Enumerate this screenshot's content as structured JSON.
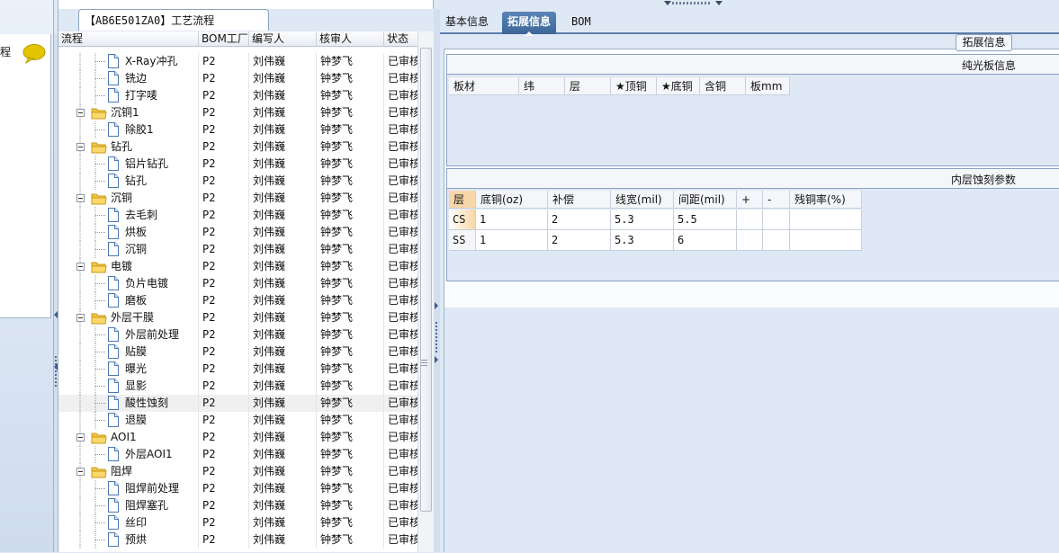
{
  "left_panel": {
    "label": "程",
    "icon": "speech-bubble-icon",
    "icon_color": "#e4c300"
  },
  "process_panel": {
    "title": "【AB6E501ZA0】工艺流程",
    "columns": [
      "流程",
      "BOM工厂",
      "编写人",
      "核审人",
      "状态"
    ],
    "rows": [
      {
        "level": 2,
        "type": "step",
        "name": "X-Ray冲孔",
        "bom": "P2",
        "writer": "刘伟巍",
        "checker": "钟梦飞",
        "status": "已审核"
      },
      {
        "level": 2,
        "type": "step",
        "name": "铣边",
        "bom": "P2",
        "writer": "刘伟巍",
        "checker": "钟梦飞",
        "status": "已审核"
      },
      {
        "level": 2,
        "type": "step",
        "name": "打字唛",
        "bom": "P2",
        "writer": "刘伟巍",
        "checker": "钟梦飞",
        "status": "已审核"
      },
      {
        "level": 1,
        "type": "folder",
        "name": "沉铜1",
        "bom": "P2",
        "writer": "刘伟巍",
        "checker": "钟梦飞",
        "status": "已审核"
      },
      {
        "level": 2,
        "type": "step",
        "name": "除胶1",
        "bom": "P2",
        "writer": "刘伟巍",
        "checker": "钟梦飞",
        "status": "已审核"
      },
      {
        "level": 1,
        "type": "folder",
        "name": "钻孔",
        "bom": "P2",
        "writer": "刘伟巍",
        "checker": "钟梦飞",
        "status": "已审核"
      },
      {
        "level": 2,
        "type": "step",
        "name": "铝片钻孔",
        "bom": "P2",
        "writer": "刘伟巍",
        "checker": "钟梦飞",
        "status": "已审核"
      },
      {
        "level": 2,
        "type": "step",
        "name": "钻孔",
        "bom": "P2",
        "writer": "刘伟巍",
        "checker": "钟梦飞",
        "status": "已审核"
      },
      {
        "level": 1,
        "type": "folder",
        "name": "沉铜",
        "bom": "P2",
        "writer": "刘伟巍",
        "checker": "钟梦飞",
        "status": "已审核"
      },
      {
        "level": 2,
        "type": "step",
        "name": "去毛刺",
        "bom": "P2",
        "writer": "刘伟巍",
        "checker": "钟梦飞",
        "status": "已审核"
      },
      {
        "level": 2,
        "type": "step",
        "name": "烘板",
        "bom": "P2",
        "writer": "刘伟巍",
        "checker": "钟梦飞",
        "status": "已审核"
      },
      {
        "level": 2,
        "type": "step",
        "name": "沉铜",
        "bom": "P2",
        "writer": "刘伟巍",
        "checker": "钟梦飞",
        "status": "已审核"
      },
      {
        "level": 1,
        "type": "folder",
        "name": "电镀",
        "bom": "P2",
        "writer": "刘伟巍",
        "checker": "钟梦飞",
        "status": "已审核"
      },
      {
        "level": 2,
        "type": "step",
        "name": "负片电镀",
        "bom": "P2",
        "writer": "刘伟巍",
        "checker": "钟梦飞",
        "status": "已审核"
      },
      {
        "level": 2,
        "type": "step",
        "name": "磨板",
        "bom": "P2",
        "writer": "刘伟巍",
        "checker": "钟梦飞",
        "status": "已审核"
      },
      {
        "level": 1,
        "type": "folder",
        "name": "外层干膜",
        "bom": "P2",
        "writer": "刘伟巍",
        "checker": "钟梦飞",
        "status": "已审核"
      },
      {
        "level": 2,
        "type": "step",
        "name": "外层前处理",
        "bom": "P2",
        "writer": "刘伟巍",
        "checker": "钟梦飞",
        "status": "已审核"
      },
      {
        "level": 2,
        "type": "step",
        "name": "贴膜",
        "bom": "P2",
        "writer": "刘伟巍",
        "checker": "钟梦飞",
        "status": "已审核"
      },
      {
        "level": 2,
        "type": "step",
        "name": "曝光",
        "bom": "P2",
        "writer": "刘伟巍",
        "checker": "钟梦飞",
        "status": "已审核"
      },
      {
        "level": 2,
        "type": "step",
        "name": "显影",
        "bom": "P2",
        "writer": "刘伟巍",
        "checker": "钟梦飞",
        "status": "已审核"
      },
      {
        "level": 2,
        "type": "step",
        "name": "酸性蚀刻",
        "bom": "P2",
        "writer": "刘伟巍",
        "checker": "钟梦飞",
        "status": "已审核",
        "selected": true
      },
      {
        "level": 2,
        "type": "step",
        "name": "退膜",
        "bom": "P2",
        "writer": "刘伟巍",
        "checker": "钟梦飞",
        "status": "已审核"
      },
      {
        "level": 1,
        "type": "folder",
        "name": "AOI1",
        "bom": "P2",
        "writer": "刘伟巍",
        "checker": "钟梦飞",
        "status": "已审核"
      },
      {
        "level": 2,
        "type": "step",
        "name": "外层AOI1",
        "bom": "P2",
        "writer": "刘伟巍",
        "checker": "钟梦飞",
        "status": "已审核"
      },
      {
        "level": 1,
        "type": "folder",
        "name": "阻焊",
        "bom": "P2",
        "writer": "刘伟巍",
        "checker": "钟梦飞",
        "status": "已审核"
      },
      {
        "level": 2,
        "type": "step",
        "name": "阻焊前处理",
        "bom": "P2",
        "writer": "刘伟巍",
        "checker": "钟梦飞",
        "status": "已审核"
      },
      {
        "level": 2,
        "type": "step",
        "name": "阻焊塞孔",
        "bom": "P2",
        "writer": "刘伟巍",
        "checker": "钟梦飞",
        "status": "已审核"
      },
      {
        "level": 2,
        "type": "step",
        "name": "丝印",
        "bom": "P2",
        "writer": "刘伟巍",
        "checker": "钟梦飞",
        "status": "已审核"
      },
      {
        "level": 2,
        "type": "step",
        "name": "预烘",
        "bom": "P2",
        "writer": "刘伟巍",
        "checker": "钟梦飞",
        "status": "已审核"
      }
    ]
  },
  "tabs": [
    "基本信息",
    "拓展信息",
    "BOM"
  ],
  "active_tab": 1,
  "ext_info": {
    "group_title": "拓展信息",
    "board": {
      "title": "纯光板信息",
      "columns": [
        "板材",
        "纬",
        "层",
        "★顶铜",
        "★底铜",
        "含铜",
        "板mm"
      ]
    },
    "etch": {
      "title": "内层蚀刻参数",
      "columns": [
        "层",
        "底铜(oz)",
        "补偿",
        "线宽(mil)",
        "间距(mil)",
        "+",
        "-",
        "残铜率(%)"
      ],
      "rows": [
        [
          "CS",
          "1",
          "2",
          "5.3",
          "5.5",
          "",
          "",
          ""
        ],
        [
          "SS",
          "1",
          "2",
          "5.3",
          "6",
          "",
          "",
          ""
        ]
      ]
    }
  }
}
